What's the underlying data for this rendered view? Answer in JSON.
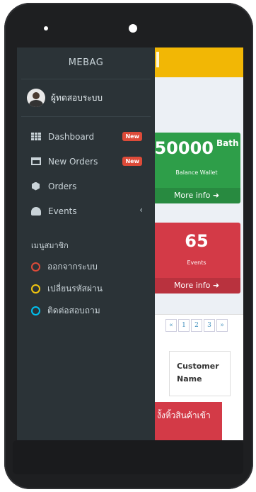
{
  "sidebar": {
    "brand": "MEBAG",
    "user": {
      "name": "ผู้ทดสอบระบบ"
    },
    "menu": [
      {
        "label": "Dashboard",
        "icon": "dashboard-grid-icon",
        "badge": "New"
      },
      {
        "label": "New Orders",
        "icon": "inbox-icon",
        "badge": "New"
      },
      {
        "label": "Orders",
        "icon": "cube-icon"
      },
      {
        "label": "Events",
        "icon": "dashboard-gauge-icon",
        "chevron": "‹"
      }
    ],
    "member_section": {
      "title": "เมนูสมาชิก",
      "items": [
        {
          "label": "ออกจากระบบ",
          "color": "#dd4b39"
        },
        {
          "label": "เปลี่ยนรหัสผ่าน",
          "color": "#f39c12"
        },
        {
          "label": "ติดต่อสอบถาม",
          "color": "#00c0ef"
        }
      ]
    }
  },
  "content": {
    "wallet_card": {
      "value": "50000",
      "unit": "Bath",
      "label": "Balance Wallet",
      "link": "More info ➜"
    },
    "events_card": {
      "value": "65",
      "label": "Events",
      "link": "More info ➜"
    },
    "pagination": [
      "«",
      "1",
      "2",
      "3",
      "»"
    ],
    "table_header": {
      "col": "Customer Name"
    },
    "banner_text": "งั้งหิ้วสินค้าเข้า"
  },
  "colors": {
    "header": "#f2b705",
    "green": "#2e9e49",
    "red": "#d33a47",
    "sidebar": "#2b3337"
  }
}
